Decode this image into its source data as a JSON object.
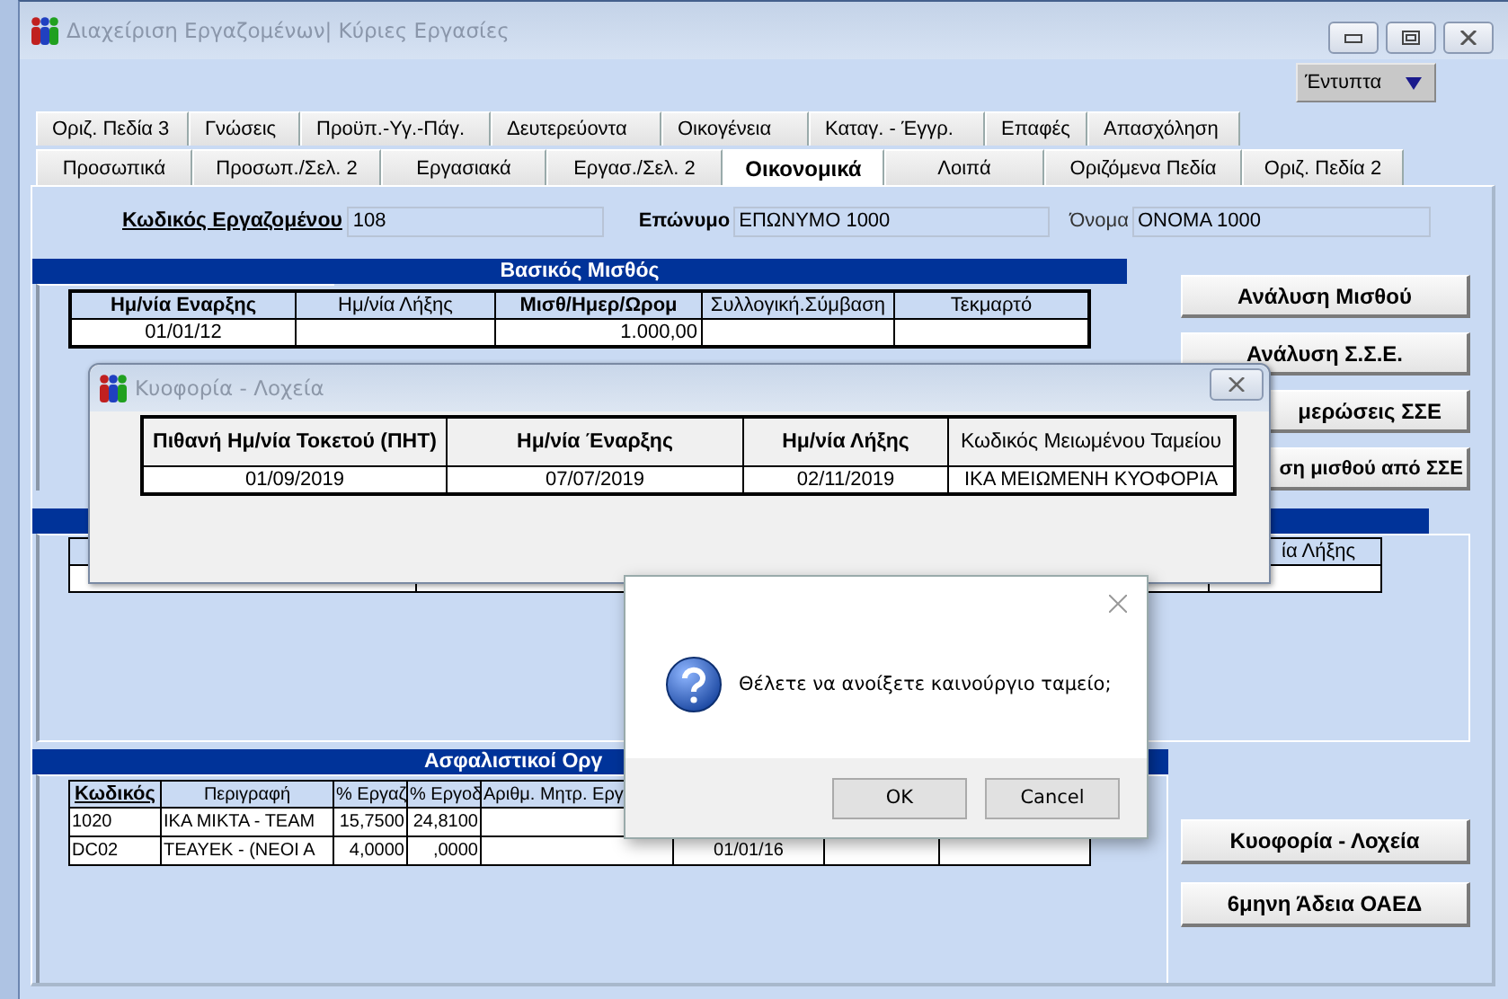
{
  "window": {
    "title": "Διαχείριση Εργαζομένων| Κύριες Εργασίες"
  },
  "print_menu": {
    "label": "Έντυπτα"
  },
  "tabs_top": [
    {
      "label": "Οριζ. Πεδία 3",
      "selected": false
    },
    {
      "label": "Γνώσεις",
      "selected": false
    },
    {
      "label": "Προϋπ.-Υγ.-Πάγ.",
      "selected": false
    },
    {
      "label": "Δευτερεύοντα",
      "selected": false
    },
    {
      "label": "Οικογένεια",
      "selected": false
    },
    {
      "label": "Καταγ. - Έγγρ.",
      "selected": false
    },
    {
      "label": "Επαφές",
      "selected": false
    },
    {
      "label": "Απασχόληση",
      "selected": false
    }
  ],
  "tabs_bottom": [
    {
      "label": "Προσωπικά",
      "selected": false
    },
    {
      "label": "Προσωπ./Σελ. 2",
      "selected": false
    },
    {
      "label": "Εργασιακά",
      "selected": false
    },
    {
      "label": "Εργασ./Σελ. 2",
      "selected": false
    },
    {
      "label": "Οικονομικά",
      "selected": true
    },
    {
      "label": "Λοιπά",
      "selected": false
    },
    {
      "label": "Οριζόμενα Πεδία",
      "selected": false
    },
    {
      "label": "Οριζ. Πεδία 2",
      "selected": false
    }
  ],
  "employee_fields": [
    {
      "label": "Κωδικός Εργαζομένου",
      "value": "108",
      "kind": "key"
    },
    {
      "label": "Επώνυμο",
      "value": "ΕΠΩΝΥΜΟ 1000",
      "kind": "bold"
    },
    {
      "label": "Όνομα",
      "value": "ΟΝΟΜΑ 1000",
      "kind": "plain"
    }
  ],
  "basic_salary": {
    "title": "Βασικός Μισθός",
    "columns": [
      {
        "label": "Ημ/νία Εναρξης",
        "bold": true
      },
      {
        "label": "Ημ/νία Λήξης",
        "bold": false
      },
      {
        "label": "Μισθ/Ημερ/Ωρομ",
        "bold": true
      },
      {
        "label": "Συλλογική.Σύμβαση",
        "bold": false
      },
      {
        "label": "Τεκμαρτό",
        "bold": false
      }
    ],
    "rows": [
      {
        "start_date": "01/01/12",
        "salary": "1.000,00"
      }
    ]
  },
  "salary_buttons": [
    "Ανάλυση Μισθού",
    "Ανάλυση Σ.Σ.Ε.",
    "μερώσεις ΣΣΕ",
    "ση μισθού από ΣΣΕ"
  ],
  "second_section": {
    "column_3": "ία Λήξης"
  },
  "insurance": {
    "title": "Ασφαλιστικοί Οργ",
    "columns": [
      "Κωδικός",
      "Περιγραφή",
      "% Εργαζ",
      "% Εργοδ",
      "Αριθμ. Μητρ. Εργ"
    ],
    "rows": [
      {
        "code": "1020",
        "description": "ΙΚΑ ΜΙΚΤΑ - ΤΕΑΜ",
        "employee_pct": "15,7500",
        "employer_pct": "24,8100"
      },
      {
        "code": "DC02",
        "description": "ΤΕΑΥΕΚ - (ΝΕΟΙ Α",
        "employee_pct": "4,0000",
        "employer_pct": ",0000",
        "column_6": "01/01/16"
      }
    ]
  },
  "side_buttons": [
    "Κυοφορία - Λοχεία",
    "6μηνη Άδεια ΟΑΕΔ"
  ],
  "maternity_dialog": {
    "title": "Κυοφορία - Λοχεία",
    "columns": [
      {
        "label": "Πιθανή Ημ/νία Τοκετού (ΠΗΤ)",
        "bold": true
      },
      {
        "label": "Ημ/νία Έναρξης",
        "bold": true
      },
      {
        "label": "Ημ/νία Λήξης",
        "bold": true
      },
      {
        "label": "Κωδικός Μειωμένου Ταμείου",
        "bold": false
      }
    ],
    "rows": [
      [
        "01/09/2019",
        "07/07/2019",
        "02/11/2019",
        "ΙΚΑ ΜΕΙΩΜΕΝΗ ΚΥΟΦΟΡΙΑ"
      ]
    ]
  },
  "message_box": {
    "text": "Θέλετε να ανοίξετε καινούργιο ταμείο;",
    "buttons": [
      "OK",
      "Cancel"
    ]
  }
}
